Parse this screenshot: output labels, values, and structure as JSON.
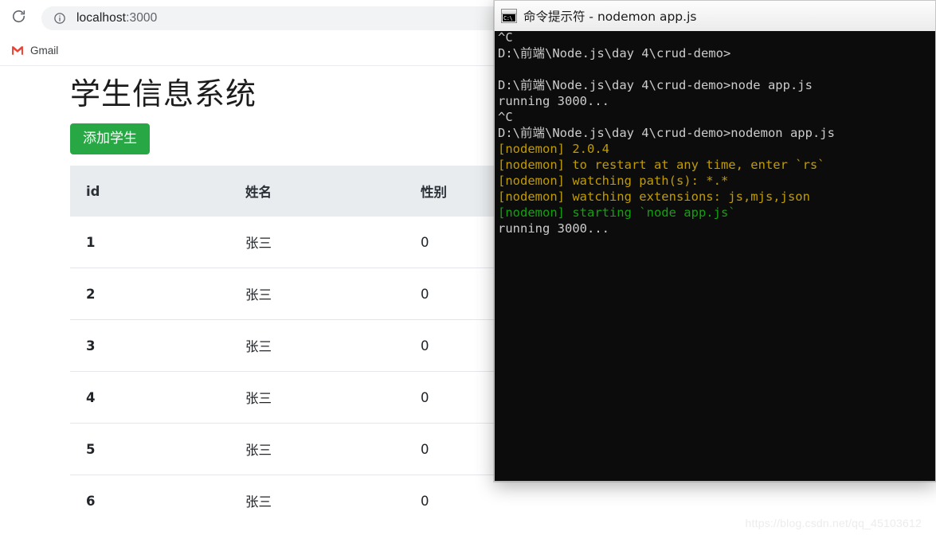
{
  "browser": {
    "reload_icon": "reload-icon",
    "site_info_icon": "info-circle-icon",
    "url_host": "localhost",
    "url_port": ":3000",
    "bookmarks": [
      {
        "icon": "gmail-icon",
        "label": "Gmail"
      }
    ]
  },
  "page": {
    "title": "学生信息系统",
    "add_button_label": "添加学生",
    "table": {
      "columns": [
        "id",
        "姓名",
        "性别"
      ],
      "rows": [
        {
          "id": "1",
          "name": "张三",
          "sex": "0"
        },
        {
          "id": "2",
          "name": "张三",
          "sex": "0"
        },
        {
          "id": "3",
          "name": "张三",
          "sex": "0"
        },
        {
          "id": "4",
          "name": "张三",
          "sex": "0"
        },
        {
          "id": "5",
          "name": "张三",
          "sex": "0"
        },
        {
          "id": "6",
          "name": "张三",
          "sex": "0"
        }
      ]
    },
    "watermark": "https://blog.csdn.net/qq_45103612"
  },
  "cmd": {
    "app_icon": "cmd-icon",
    "icon_glyph": "C:\\",
    "title": "命令提示符 - nodemon app.js",
    "lines": [
      [
        {
          "text": "^C",
          "color": "default"
        }
      ],
      [
        {
          "text": "D:\\前端\\Node.js\\day 4\\crud-demo>",
          "color": "default"
        }
      ],
      [
        {
          "text": "",
          "color": "default"
        }
      ],
      [
        {
          "text": "D:\\前端\\Node.js\\day 4\\crud-demo>node app.js",
          "color": "default"
        }
      ],
      [
        {
          "text": "running 3000...",
          "color": "default"
        }
      ],
      [
        {
          "text": "^C",
          "color": "default"
        }
      ],
      [
        {
          "text": "D:\\前端\\Node.js\\day 4\\crud-demo>nodemon app.js",
          "color": "default"
        }
      ],
      [
        {
          "text": "[nodemon] 2.0.4",
          "color": "yellow"
        }
      ],
      [
        {
          "text": "[nodemon] to restart at any time, enter `rs`",
          "color": "yellow"
        }
      ],
      [
        {
          "text": "[nodemon] watching path(s): *.*",
          "color": "yellow"
        }
      ],
      [
        {
          "text": "[nodemon] watching extensions: js,mjs,json",
          "color": "yellow"
        }
      ],
      [
        {
          "text": "[nodemon] starting `node app.js`",
          "color": "green"
        }
      ],
      [
        {
          "text": "running 3000...",
          "color": "default"
        }
      ]
    ]
  },
  "colors": {
    "button_green": "#28a745",
    "table_header_bg": "#e9ecef",
    "console_bg": "#0c0c0c",
    "console_text": "#cccccc",
    "console_yellow": "#c19c00",
    "console_green": "#13a10e"
  }
}
